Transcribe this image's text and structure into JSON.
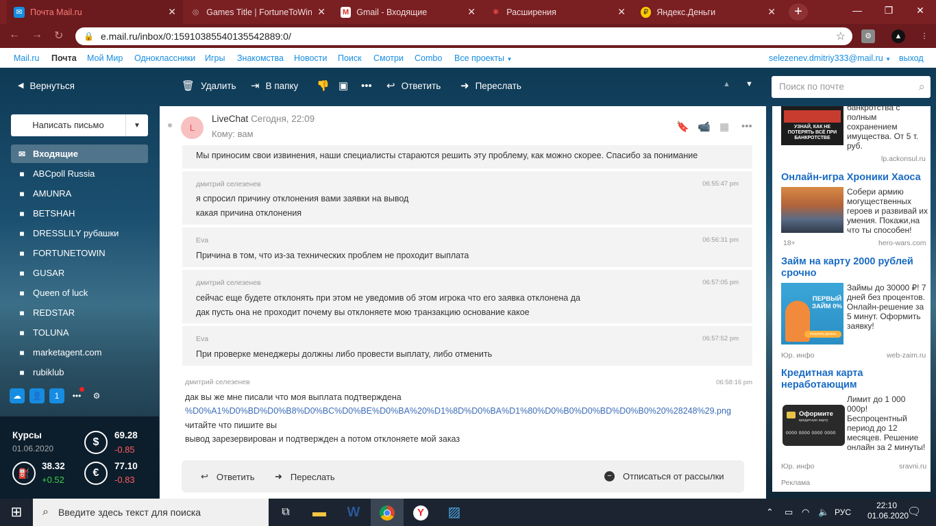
{
  "browser": {
    "tabs": [
      {
        "title": "Почта Mail.ru",
        "favicon": "mail-envelope-icon",
        "active": true
      },
      {
        "title": "Games Title | FortuneToWin",
        "favicon": "globe-icon",
        "active": false
      },
      {
        "title": "Gmail - Входящие",
        "favicon": "gmail-icon",
        "active": false
      },
      {
        "title": "Расширения",
        "favicon": "puzzle-icon",
        "active": false
      },
      {
        "title": "Яндекс.Деньги",
        "favicon": "yandex-money-icon",
        "active": false
      }
    ],
    "url": "e.mail.ru/inbox/0:15910385540135542889:0/",
    "colors": {
      "tab_strip": "#7a1f22",
      "active_tab_text": "#ff7b7b"
    }
  },
  "portal": {
    "links": [
      "Mail.ru",
      "Почта",
      "Мой Мир",
      "Одноклассники",
      "Игры",
      "Знакомства",
      "Новости",
      "Поиск",
      "Смотри",
      "Combo",
      "Все проекты"
    ],
    "user": "selezenev.dmitriy333@mail.ru",
    "logout": "выход"
  },
  "toolbar": {
    "back": "Вернуться",
    "delete": "Удалить",
    "to_folder": "В папку",
    "reply": "Ответить",
    "forward": "Переслать",
    "search_placeholder": "Поиск по почте"
  },
  "sidebar": {
    "compose": "Написать письмо",
    "folders": [
      "Входящие",
      "ABCpoll Russia",
      "AMUNRA",
      "BETSHAH",
      "DRESSLILY рубашки",
      "FORTUNETOWIN",
      "GUSAR",
      "Queen of luck",
      "REDSTAR",
      "TOLUNA",
      "marketagent.com",
      "rubiklub"
    ]
  },
  "rates": {
    "title": "Курсы",
    "date": "01.06.2020",
    "usd": {
      "value": "69.28",
      "change": "-0.85"
    },
    "oil": {
      "value": "38.32",
      "change": "+0.52"
    },
    "eur": {
      "value": "77.10",
      "change": "-0.83"
    }
  },
  "message": {
    "avatar_letter": "L",
    "sender": "LiveChat",
    "date": "Сегодня, 22:09",
    "to": "Кому: вам",
    "cut_line": "Мы приносим свои извинения, наши специалисты стараются решить эту проблему, как можно скорее. Спасибо за понимание",
    "blocks": [
      {
        "author": "дмитрий селезенев",
        "time": "06:55:47 pm",
        "lines": [
          "я спросил причину отклонения вами заявки на вывод",
          "какая причина отклонения"
        ]
      },
      {
        "author": "Eva",
        "time": "06:56:31 pm",
        "lines": [
          "Причина в том, что из-за технических проблем не проходит выплата"
        ]
      },
      {
        "author": "дмитрий селезенев",
        "time": "06:57:05 pm",
        "lines": [
          "сейчас еще будете отклонять при этом не уведомив об этом игрока что его заявка отклонена да",
          "дак пусть она не проходит почему вы отклоняете мою транзакцию основание какое"
        ]
      },
      {
        "author": "Eva",
        "time": "06:57:52 pm",
        "lines": [
          "При проверке менеджеры должны либо провести выплату, либо отменить"
        ]
      },
      {
        "author": "дмитрий селезенев",
        "time": "06:58:16 pm",
        "lines": [
          "дак вы же мне писали что моя выплата подтверждена",
          "%D0%A1%D0%BD%D0%B8%D0%BC%D0%BE%D0%BA%20%D1%8D%D0%BA%D1%80%D0%B0%D0%BD%D0%B0%20%28248%29.png",
          "читайте что пишите вы",
          "вывод зарезервирован и подтвержден а потом отклоняете мой заказ"
        ]
      }
    ],
    "reply": "Ответить",
    "forward": "Переслать",
    "unsubscribe": "Отписаться от рассылки"
  },
  "ads": [
    {
      "title": "",
      "text": "банкротства с полным сохранением имущества. От 5 т. руб.",
      "source": "lp.ackonsul.ru",
      "image_caption": "УЗНАЙ, КАК НЕ ПОТЕРЯТЬ ВСЁ ПРИ БАНКРОТСТВЕ",
      "left": ""
    },
    {
      "title": "Онлайн-игра Хроники Хаоса",
      "text": "Собери армию могущественных героев и развивай их умения. Покажи,на что ты способен!",
      "source": "hero-wars.com",
      "left": "18+"
    },
    {
      "title": "Займ на карту 2000 рублей срочно",
      "text": "Займы до 30000 ₽! 7 дней без процентов. Онлайн-решение за 5 минут. Оформить заявку!",
      "source": "web-zaim.ru",
      "left": "Юр. инфо",
      "image_caption": "ПЕРВЫЙ ЗАЙМ 0%",
      "image_button": "получить деньги"
    },
    {
      "title": "Кредитная карта неработающим",
      "text": "Лимит до 1 000 000р! Беспроцентный период до 12 месяцев. Решение онлайн за 2 минуты!",
      "source": "sravni.ru",
      "left": "Юр. инфо",
      "image_caption": "Оформите",
      "image_subcaption": "кредитную карту",
      "image_number": "0000 0000 0000 0000"
    }
  ],
  "ads_footer": "Реклама",
  "taskbar": {
    "search_placeholder": "Введите здесь текст для поиска",
    "lang": "РУС",
    "time": "22:10",
    "date": "01.06.2020"
  }
}
